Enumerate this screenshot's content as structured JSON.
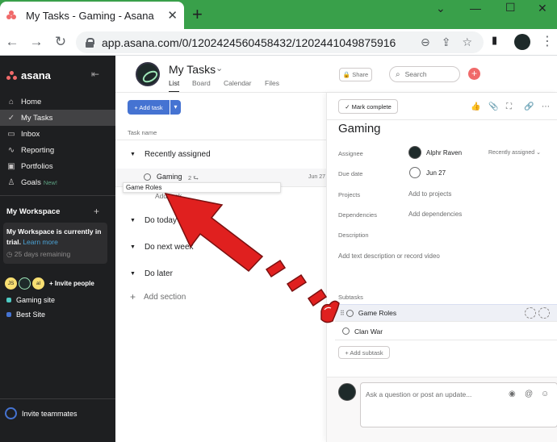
{
  "browser": {
    "tab_title": "My Tasks - Gaming - Asana",
    "tab_close": "✕",
    "new_tab": "+",
    "window_controls": [
      "⌄",
      "—",
      "☐",
      "✕"
    ],
    "url": "app.asana.com/0/1202424560458432/1202441049875916",
    "nav": {
      "back": "←",
      "forward": "→",
      "reload": "↻"
    },
    "omni_icons": [
      "⊖",
      "⇪",
      "☆"
    ],
    "menu": "⋮",
    "sidepanel": "▮"
  },
  "sidebar": {
    "brand": "asana",
    "collapse_icon": "⇤",
    "nav": [
      {
        "label": "Home",
        "icon": "⌂"
      },
      {
        "label": "My Tasks",
        "icon": "✓"
      },
      {
        "label": "Inbox",
        "icon": "▭"
      },
      {
        "label": "Reporting",
        "icon": "∿"
      },
      {
        "label": "Portfolios",
        "icon": "▣"
      },
      {
        "label": "Goals",
        "icon": "♙",
        "badge": "New!"
      }
    ],
    "workspace_title": "My Workspace",
    "workspace_plus": "+",
    "trial_text_1": "My Workspace is currently in",
    "trial_text_2": "trial.",
    "trial_link": "Learn more",
    "trial_remaining": "◷ 25 days remaining",
    "people": [
      "JS",
      "",
      "al"
    ],
    "invite_people": "+ Invite people",
    "projects": [
      {
        "name": "Gaming site",
        "color": "#4ecbc4"
      },
      {
        "name": "Best Site",
        "color": "#4573d2"
      }
    ],
    "invite_teammates": "Invite teammates"
  },
  "header": {
    "title": "My Tasks",
    "caret": "⌄",
    "tabs": [
      "List",
      "Board",
      "Calendar",
      "Files"
    ],
    "share": "🔒 Share",
    "search_placeholder": "Search",
    "search_icon": "⌕",
    "plus": "+"
  },
  "list": {
    "add_task": "+ Add task",
    "add_task_dd": "▾",
    "column_task_name": "Task name",
    "sections": [
      {
        "title": "Recently assigned"
      },
      {
        "title": "Do today"
      },
      {
        "title": "Do next week"
      },
      {
        "title": "Do later"
      }
    ],
    "section_toggle": "▼",
    "add_section": "Add section",
    "add_section_icon": "+",
    "task": {
      "name": "Gaming",
      "subtasks": "2 ⮑",
      "due": "Jun 27"
    },
    "drag_ghost": "Game Roles",
    "add_task_inline": "Add task..."
  },
  "detail": {
    "mark_complete": "✓ Mark complete",
    "toolbar_icons": [
      "👍",
      "📎",
      "⛶",
      "🔗",
      "⋯"
    ],
    "title": "Gaming",
    "fields": {
      "assignee_label": "Assignee",
      "assignee_value": "Alphr Raven",
      "assignee_section": "Recently assigned ⌄",
      "due_label": "Due date",
      "due_value": "Jun 27",
      "projects_label": "Projects",
      "projects_value": "Add to projects",
      "dependencies_label": "Dependencies",
      "dependencies_value": "Add dependencies",
      "description_label": "Description"
    },
    "description_placeholder": "Add text description or record video",
    "subtasks_label": "Subtasks",
    "subtasks": [
      {
        "name": "Game Roles",
        "grip": "⠿"
      },
      {
        "name": "Clan War"
      }
    ],
    "add_subtask": "+ Add subtask",
    "comment_placeholder": "Ask a question or post an update...",
    "comment_icons": [
      "◉",
      "@",
      "☺"
    ]
  },
  "colors": {
    "accent": "#4573d2",
    "brand": "#f06a6a",
    "sidebar_bg": "#1e1f21",
    "annotation": "#e0201f"
  }
}
